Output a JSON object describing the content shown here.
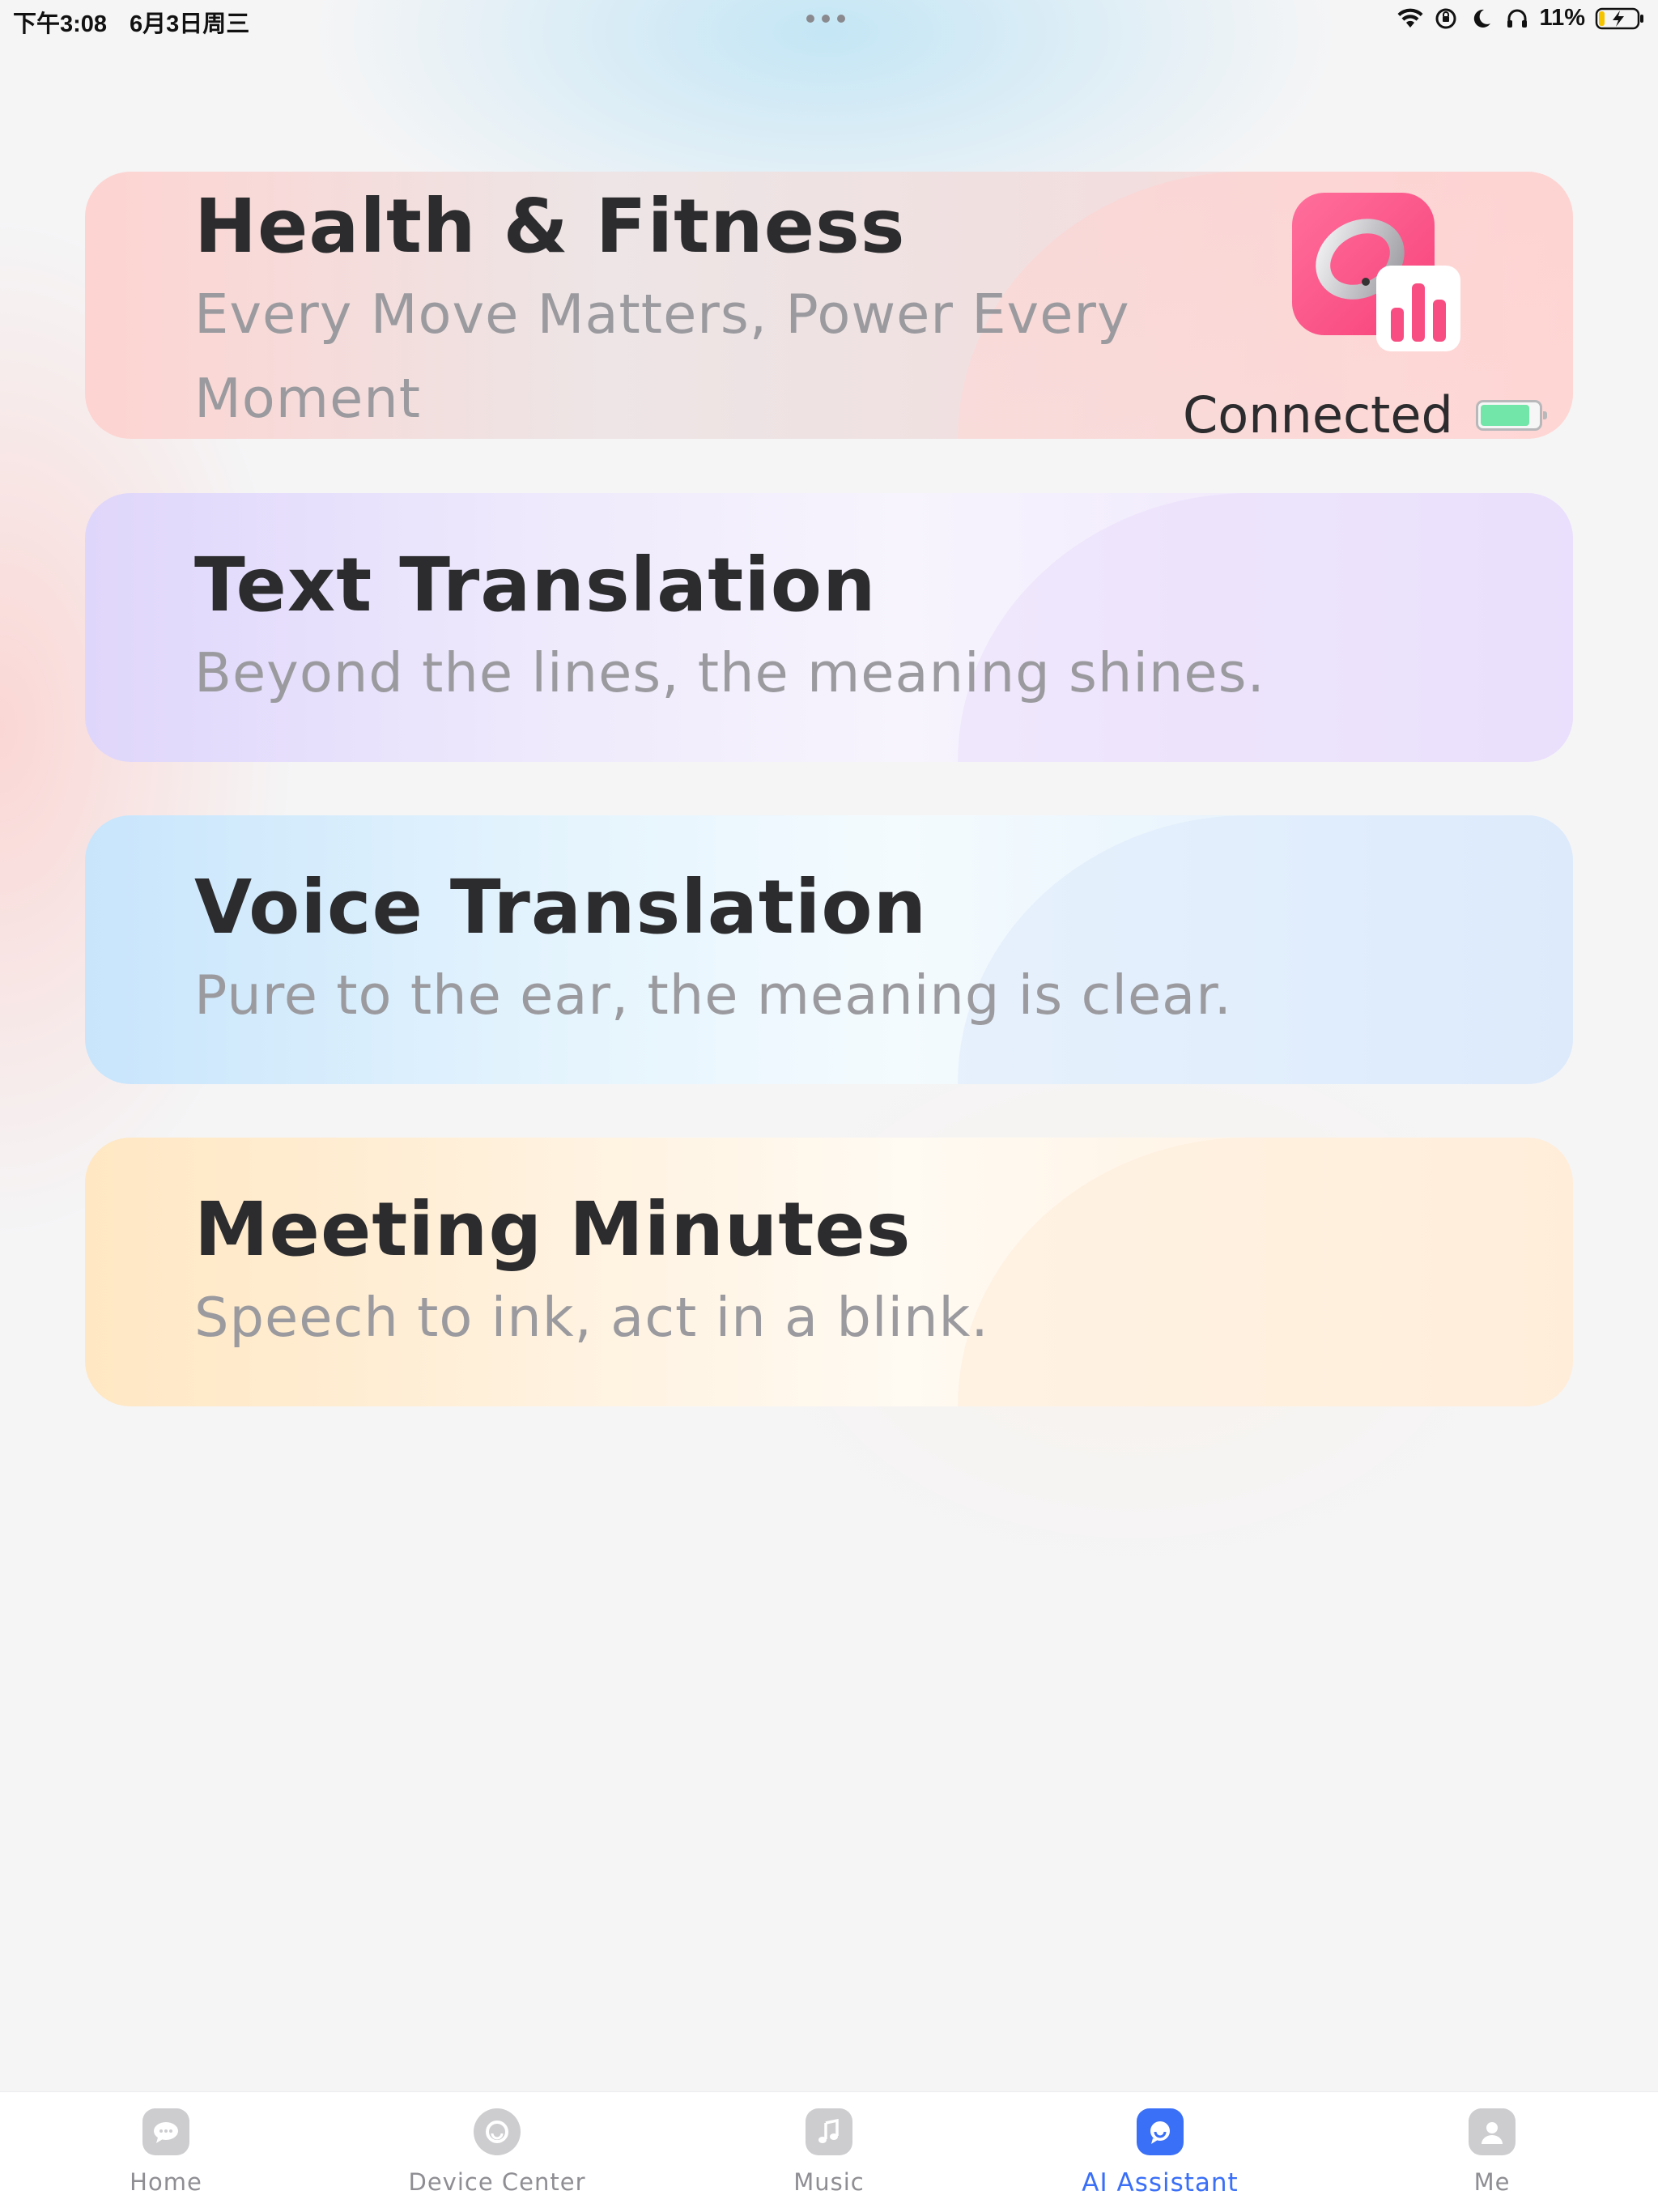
{
  "status_bar": {
    "time": "下午3:08",
    "date": "6月3日周三",
    "battery_percent": "11%",
    "icons": [
      "wifi-icon",
      "orientation-lock-icon",
      "moon-icon",
      "headphones-icon",
      "battery-charging-icon"
    ]
  },
  "cards": [
    {
      "title": "Health & Fitness",
      "subtitle_line1": "Every Move Matters, Power Every",
      "subtitle_line2": "Moment",
      "status": "Connected",
      "device_battery_level": 0.85,
      "icon": "smart-ring-health-icon",
      "accent": "#fd5b8d"
    },
    {
      "title": "Text Translation",
      "subtitle": "Beyond the lines, the meaning shines."
    },
    {
      "title": "Voice Translation",
      "subtitle": "Pure to the ear, the meaning is clear."
    },
    {
      "title": "Meeting Minutes",
      "subtitle": "Speech to ink, act in a blink."
    }
  ],
  "tabs": [
    {
      "label": "Home",
      "icon": "home-chat-icon",
      "active": false
    },
    {
      "label": "Device Center",
      "icon": "device-center-icon",
      "active": false
    },
    {
      "label": "Music",
      "icon": "music-note-icon",
      "active": false
    },
    {
      "label": "AI Assistant",
      "icon": "ai-assistant-icon",
      "active": true
    },
    {
      "label": "Me",
      "icon": "person-icon",
      "active": false
    }
  ],
  "colors": {
    "active_tab": "#3a6ff7",
    "inactive_tab": "#8e8e93",
    "title_text": "#2c2c2e",
    "subtitle_text": "#9b9b9f",
    "connected_battery": "#72e5a9"
  }
}
